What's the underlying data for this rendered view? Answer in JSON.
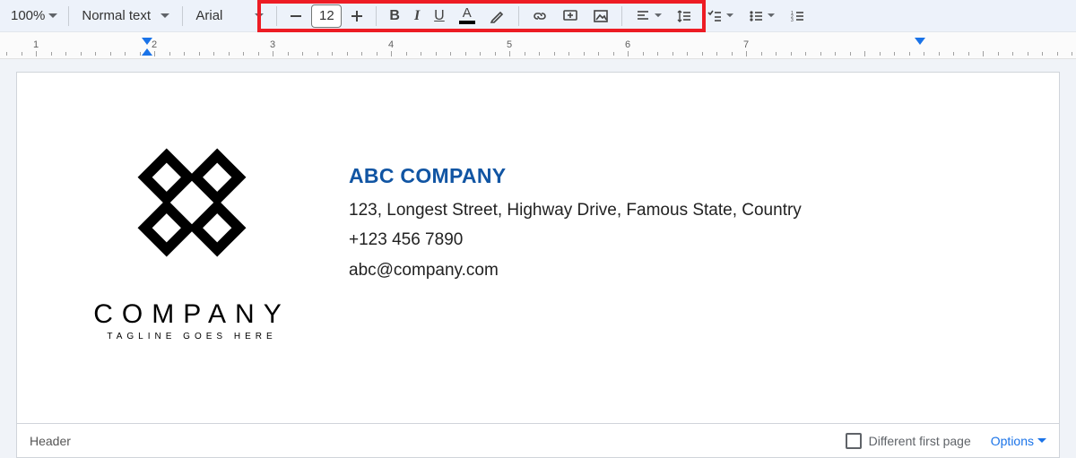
{
  "toolbar": {
    "zoom": "100%",
    "style": "Normal text",
    "font": "Arial",
    "fontSize": "12",
    "bold_glyph": "B",
    "italic_glyph": "I",
    "underline_glyph": "U",
    "textcolor_glyph": "A"
  },
  "ruler": {
    "numbers": [
      "1",
      "2",
      "3",
      "4",
      "5",
      "6",
      "7"
    ]
  },
  "document": {
    "logo": {
      "name": "COMPANY",
      "tagline": "TAGLINE GOES HERE"
    },
    "heading": "ABC COMPANY",
    "address": "123, Longest Street, Highway Drive, Famous State, Country",
    "phone": "+123 456 7890",
    "email": "abc@company.com"
  },
  "headerBar": {
    "label": "Header",
    "differentFirstPage": "Different first page",
    "options": "Options"
  }
}
